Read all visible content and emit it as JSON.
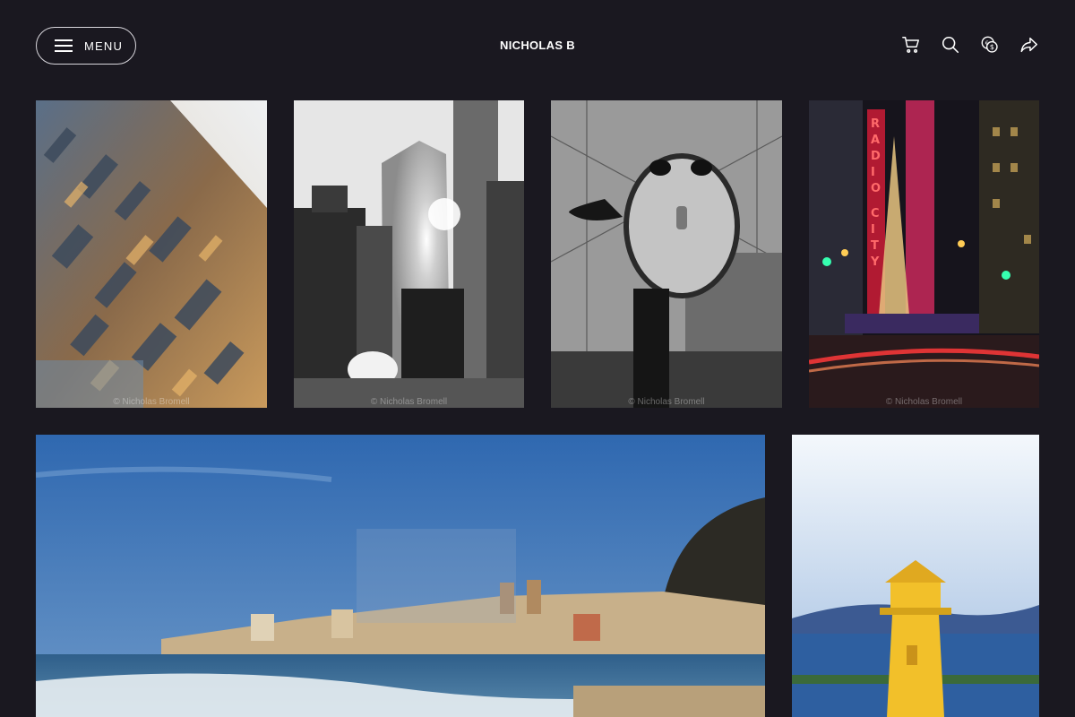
{
  "header": {
    "menu_label": "MENU",
    "site_title": "NICHOLAS B",
    "icons": [
      "cart-icon",
      "search-icon",
      "currency-icon",
      "share-icon"
    ]
  },
  "gallery": {
    "photos": [
      {
        "name": "nyc-aerial-tilted",
        "watermark": "© Nicholas Bromell"
      },
      {
        "name": "bw-skyscrapers-sunburst",
        "watermark": "© Nicholas Bromell"
      },
      {
        "name": "bw-tower-viewer-binoculars",
        "watermark": "© Nicholas Bromell"
      },
      {
        "name": "radio-city-night",
        "watermark": "© Nicholas Bromell"
      },
      {
        "name": "cefalu-coastline",
        "watermark": ""
      },
      {
        "name": "yellow-lighthouse",
        "watermark": ""
      }
    ]
  },
  "colors": {
    "background": "#1a1820",
    "text": "#ffffff",
    "menu_border": "#d8d6dc"
  }
}
